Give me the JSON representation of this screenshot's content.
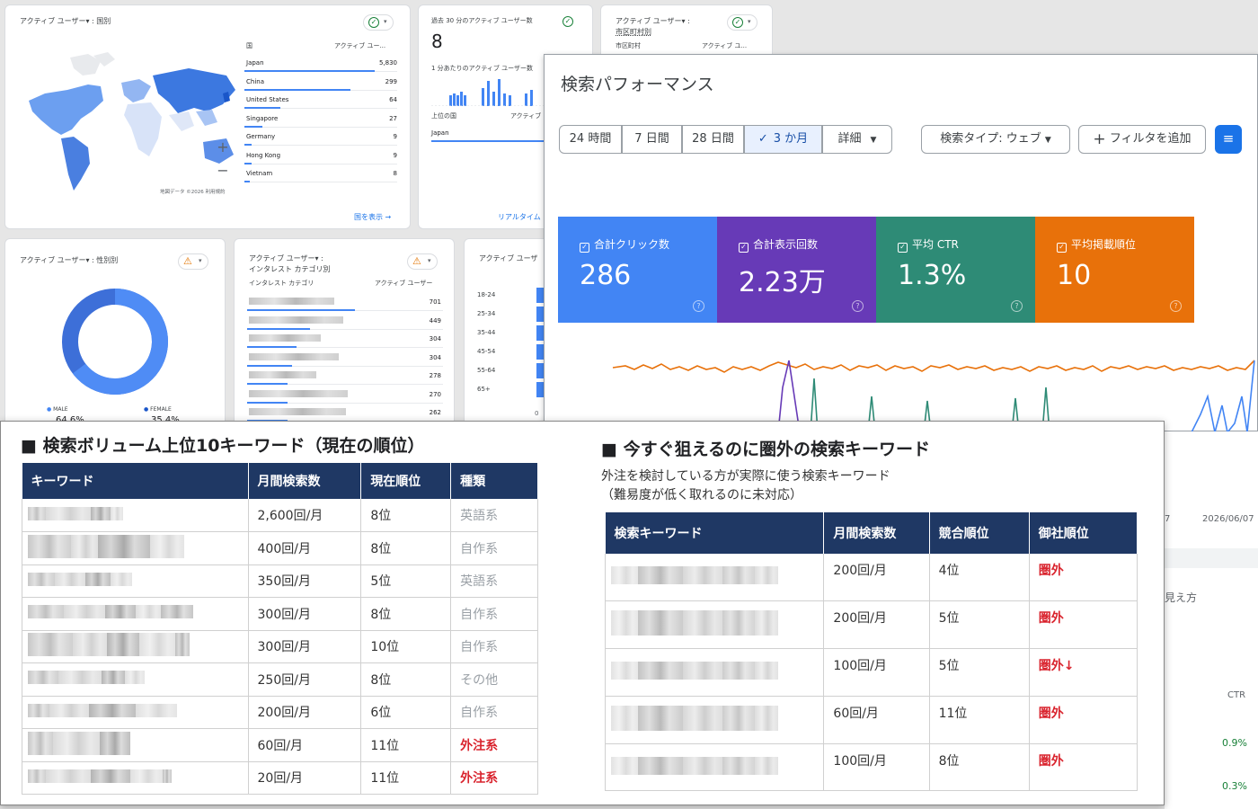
{
  "ga": {
    "country_card": {
      "title": "アクティブ ユーザー▾ : 国別",
      "col_country": "国",
      "col_users": "アクティブ ユー...",
      "rows": [
        {
          "name": "Japan",
          "value": "5,830"
        },
        {
          "name": "China",
          "value": "299"
        },
        {
          "name": "United States",
          "value": "64"
        },
        {
          "name": "Singapore",
          "value": "27"
        },
        {
          "name": "Germany",
          "value": "9"
        },
        {
          "name": "Hong Kong",
          "value": "9"
        },
        {
          "name": "Vietnam",
          "value": "8"
        }
      ],
      "map_credit": "地図データ ©2026 利用規約",
      "zoom_in": "+",
      "zoom_out": "−",
      "link": "国を表示 →"
    },
    "realtime_card": {
      "title": "過去 30 分のアクティブ ユーザー数",
      "value": "8",
      "sub": "1 分あたりのアクティブ ユーザー数",
      "col_country": "上位の国",
      "col_users": "アクティブ",
      "row": "Japan",
      "link": "リアルタイム"
    },
    "city_card": {
      "title": "アクティブ ユーザー▾ :",
      "title2": "市区町村別",
      "col_city": "市区町村",
      "col_users": "アクティブ ユ..."
    },
    "gender_card": {
      "title": "アクティブ ユーザー▾ : 性別別",
      "legend": [
        {
          "label": "MALE",
          "pct": "64.6%"
        },
        {
          "label": "FEMALE",
          "pct": "35.4%"
        }
      ]
    },
    "interest_card": {
      "title": "アクティブ ユーザー▾ :",
      "title2": "インタレスト カテゴリ別",
      "col_cat": "インタレスト カテゴリ",
      "col_users": "アクティブ ユーザー",
      "values": [
        "701",
        "449",
        "304",
        "304",
        "278",
        "270",
        "262"
      ]
    },
    "age_card": {
      "title": "アクティブ ユーザ",
      "ages": [
        "18-24",
        "25-34",
        "35-44",
        "45-54",
        "55-64",
        "65+"
      ],
      "axis0": "0"
    }
  },
  "gsc": {
    "title": "検索パフォーマンス",
    "periods": [
      "24 時間",
      "7 日間",
      "28 日間",
      "3 か月",
      "詳細"
    ],
    "selected_period": "3 か月",
    "search_type": "検索タイプ: ウェブ",
    "add_filter": "フィルタを追加",
    "metrics": [
      {
        "label": "合計クリック数",
        "value": "286",
        "color": "#4285f4"
      },
      {
        "label": "合計表示回数",
        "value": "2.23万",
        "color": "#673ab7"
      },
      {
        "label": "平均 CTR",
        "value": "1.3%",
        "color": "#2e8b76"
      },
      {
        "label": "平均掲載順位",
        "value": "10",
        "color": "#e8710a"
      }
    ],
    "date_labels": [
      "7",
      "2026/06/07"
    ],
    "side_text": "見え方",
    "ctr_header": "CTR",
    "ctr_values": [
      "0.9%",
      "0.3%"
    ]
  },
  "left_table": {
    "title": "■ 検索ボリューム上位10キーワード（現在の順位）",
    "headers": [
      "キーワード",
      "月間検索数",
      "現在順位",
      "種類"
    ],
    "rows": [
      {
        "volume": "2,600回/月",
        "rank": "8位",
        "type": "英語系",
        "style": "gray"
      },
      {
        "volume": "400回/月",
        "rank": "8位",
        "type": "自作系",
        "style": "gray"
      },
      {
        "volume": "350回/月",
        "rank": "5位",
        "type": "英語系",
        "style": "gray"
      },
      {
        "volume": "300回/月",
        "rank": "8位",
        "type": "自作系",
        "style": "gray"
      },
      {
        "volume": "300回/月",
        "rank": "10位",
        "type": "自作系",
        "style": "gray"
      },
      {
        "volume": "250回/月",
        "rank": "8位",
        "type": "その他",
        "style": "gray"
      },
      {
        "volume": "200回/月",
        "rank": "6位",
        "type": "自作系",
        "style": "gray"
      },
      {
        "volume": "60回/月",
        "rank": "11位",
        "type": "外注系",
        "style": "red"
      },
      {
        "volume": "20回/月",
        "rank": "11位",
        "type": "外注系",
        "style": "red"
      }
    ]
  },
  "right_table": {
    "title": "■ 今すぐ狙えるのに圏外の検索キーワード",
    "desc1": "外注を検討している方が実際に使う検索キーワード",
    "desc2": "（難易度が低く取れるのに未対応）",
    "headers": [
      "検索キーワード",
      "月間検索数",
      "競合順位",
      "御社順位"
    ],
    "rows": [
      {
        "volume": "200回/月",
        "comp": "4位",
        "ours": "圏外"
      },
      {
        "volume": "200回/月",
        "comp": "5位",
        "ours": "圏外"
      },
      {
        "volume": "100回/月",
        "comp": "5位",
        "ours": "圏外↓"
      },
      {
        "volume": "60回/月",
        "comp": "11位",
        "ours": "圏外"
      },
      {
        "volume": "100回/月",
        "comp": "8位",
        "ours": "圏外"
      }
    ]
  }
}
